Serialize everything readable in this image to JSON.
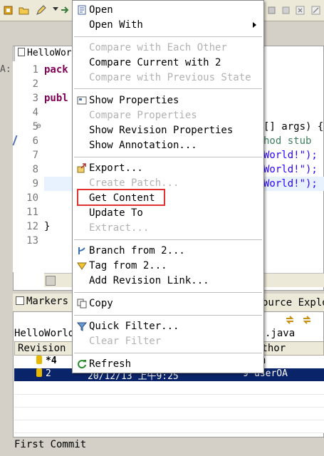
{
  "editor": {
    "tab_label": "HelloWorld",
    "side_label": "A:",
    "line_numbers": [
      "1",
      "2",
      "3",
      "4",
      "5",
      "6",
      "7",
      "8",
      "9",
      "10",
      "11",
      "12",
      "13"
    ],
    "fold_marker": "⊖",
    "code": {
      "l1": "pack",
      "l3": "publ",
      "l5_tail": "[] args) {",
      "l6_tail": "hod stub",
      "l7_tail": "World!\");",
      "l8_tail": "World!\");",
      "l9_tail": "World!\");",
      "l12": "}"
    }
  },
  "bottom": {
    "markers_tab": "Markers",
    "source_explorer_tab": "ource Explo",
    "file_label": "HelloWorld",
    "java_label": ".java",
    "columns": [
      "Revision",
      "",
      "",
      "",
      "uthor"
    ],
    "rows": [
      {
        "revision": "*4",
        "date": "",
        "changes": "",
        "author": "om"
      },
      {
        "revision": "2",
        "date": "20/12/13 上午9:25",
        "changes": "9",
        "author": "userOA"
      }
    ],
    "comment": "First Commit"
  },
  "menu": {
    "items": [
      {
        "label": "Open"
      },
      {
        "label": "Open With"
      },
      {
        "label": "Compare with Each Other"
      },
      {
        "label": "Compare Current with 2"
      },
      {
        "label": "Compare with Previous State"
      },
      {
        "label": "Show Properties"
      },
      {
        "label": "Compare Properties"
      },
      {
        "label": "Show Revision Properties"
      },
      {
        "label": "Show Annotation..."
      },
      {
        "label": "Export..."
      },
      {
        "label": "Create Patch..."
      },
      {
        "label": "Get Content"
      },
      {
        "label": "Update To"
      },
      {
        "label": "Extract..."
      },
      {
        "label": "Branch from 2..."
      },
      {
        "label": "Tag from 2..."
      },
      {
        "label": "Add Revision Link..."
      },
      {
        "label": "Copy"
      },
      {
        "label": "Quick Filter..."
      },
      {
        "label": "Clear Filter"
      },
      {
        "label": "Refresh"
      }
    ],
    "icons": {
      "open": "open-file-icon",
      "properties": "properties-icon",
      "export": "export-icon",
      "branch": "branch-icon",
      "tag": "tag-icon",
      "copy": "copy-icon",
      "filter": "filter-icon",
      "refresh": "refresh-icon"
    },
    "highlight_color": "#e03030"
  },
  "colors": {
    "selection": "#0a246a",
    "keyword": "#7f0055",
    "string": "#2a00ff",
    "comment": "#3f7f5f"
  }
}
